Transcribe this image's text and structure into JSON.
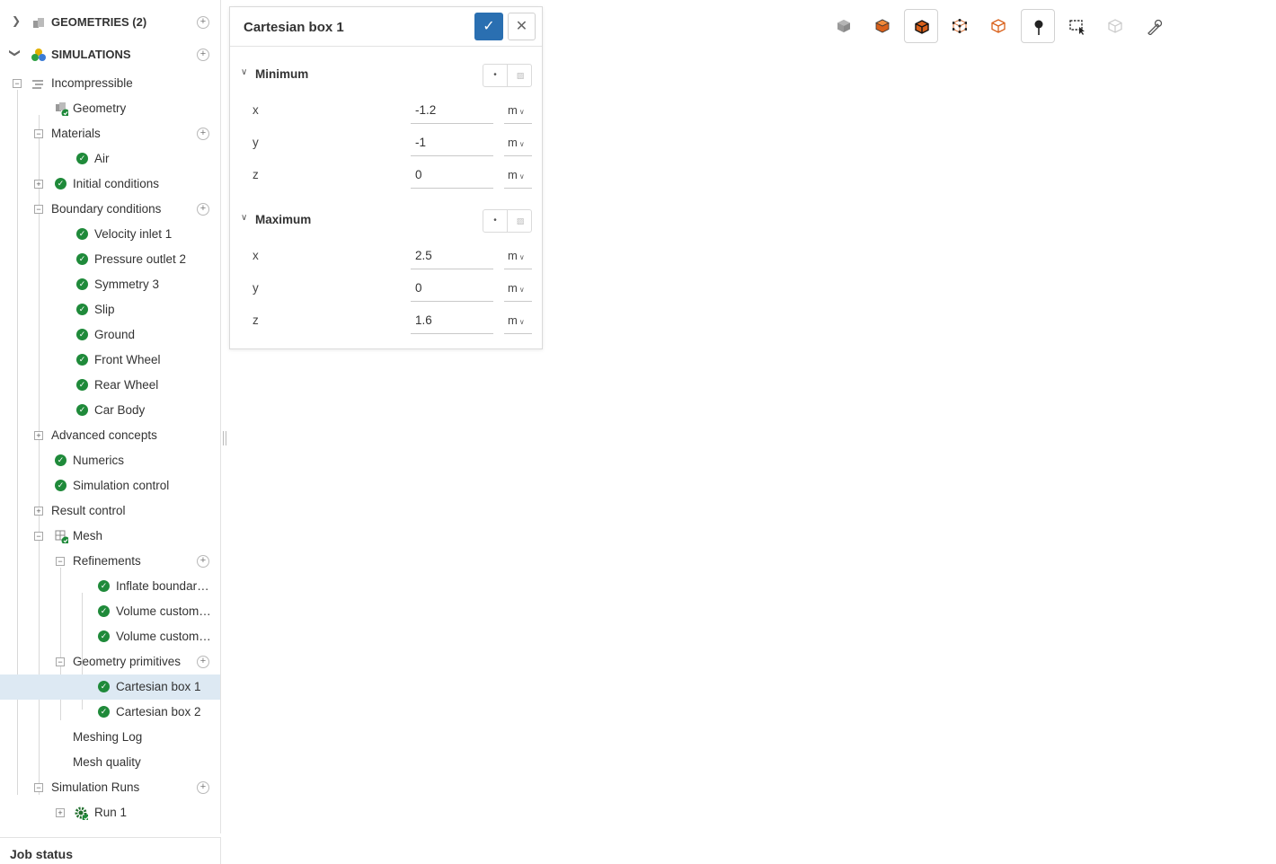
{
  "tree": {
    "geometries": {
      "label": "GEOMETRIES (2)"
    },
    "simulations": {
      "label": "SIMULATIONS"
    },
    "items": {
      "incompressible": "Incompressible",
      "geometry": "Geometry",
      "materials": "Materials",
      "air": "Air",
      "initial_conditions": "Initial conditions",
      "boundary_conditions": "Boundary conditions",
      "velocity_inlet": "Velocity inlet 1",
      "pressure_outlet": "Pressure outlet 2",
      "symmetry": "Symmetry 3",
      "slip": "Slip",
      "ground": "Ground",
      "front_wheel": "Front Wheel",
      "rear_wheel": "Rear Wheel",
      "car_body": "Car Body",
      "advanced_concepts": "Advanced concepts",
      "numerics": "Numerics",
      "simulation_control": "Simulation control",
      "result_control": "Result control",
      "mesh": "Mesh",
      "refinements": "Refinements",
      "inflate_boundary": "Inflate boundary...",
      "volume_custom_1": "Volume custom ...",
      "volume_custom_2": "Volume custom ...",
      "geometry_primitives": "Geometry primitives",
      "cartesian_box_1": "Cartesian box 1",
      "cartesian_box_2": "Cartesian box 2",
      "meshing_log": "Meshing Log",
      "mesh_quality": "Mesh quality",
      "simulation_runs": "Simulation Runs",
      "run_1": "Run 1"
    },
    "selected": "Cartesian box 1"
  },
  "job_status": {
    "label": "Job status"
  },
  "dialog": {
    "title": "Cartesian box 1",
    "minimum": {
      "title": "Minimum",
      "x": {
        "axis": "x",
        "value": "-1.2",
        "unit": "m"
      },
      "y": {
        "axis": "y",
        "value": "-1",
        "unit": "m"
      },
      "z": {
        "axis": "z",
        "value": "0",
        "unit": "m"
      }
    },
    "maximum": {
      "title": "Maximum",
      "x": {
        "axis": "x",
        "value": "2.5",
        "unit": "m"
      },
      "y": {
        "axis": "y",
        "value": "0",
        "unit": "m"
      },
      "z": {
        "axis": "z",
        "value": "1.6",
        "unit": "m"
      }
    }
  },
  "toolbar": {
    "buttons": [
      "cube-shaded-icon",
      "cube-orange-icon",
      "cube-edges-icon",
      "cube-points-icon",
      "cube-outline-icon",
      "pin-icon",
      "box-select-icon",
      "hidden-parts-icon",
      "measure-icon"
    ],
    "active": [
      "cube-edges-icon",
      "pin-icon"
    ]
  },
  "viewport": {
    "markers": {
      "top": "2",
      "left": "172",
      "mid": "15",
      "bottom": "15"
    },
    "colors": {
      "box_front": "#5a8cc3",
      "box_top": "#3b5a7a",
      "box_side": "#4d7eb2",
      "marker": "#7a7a7a",
      "car_region": "#4d4fd6"
    }
  },
  "colors": {
    "accent": "#2a6fb1",
    "check": "#1f8a3a",
    "selected_row": "#dde9f3"
  }
}
